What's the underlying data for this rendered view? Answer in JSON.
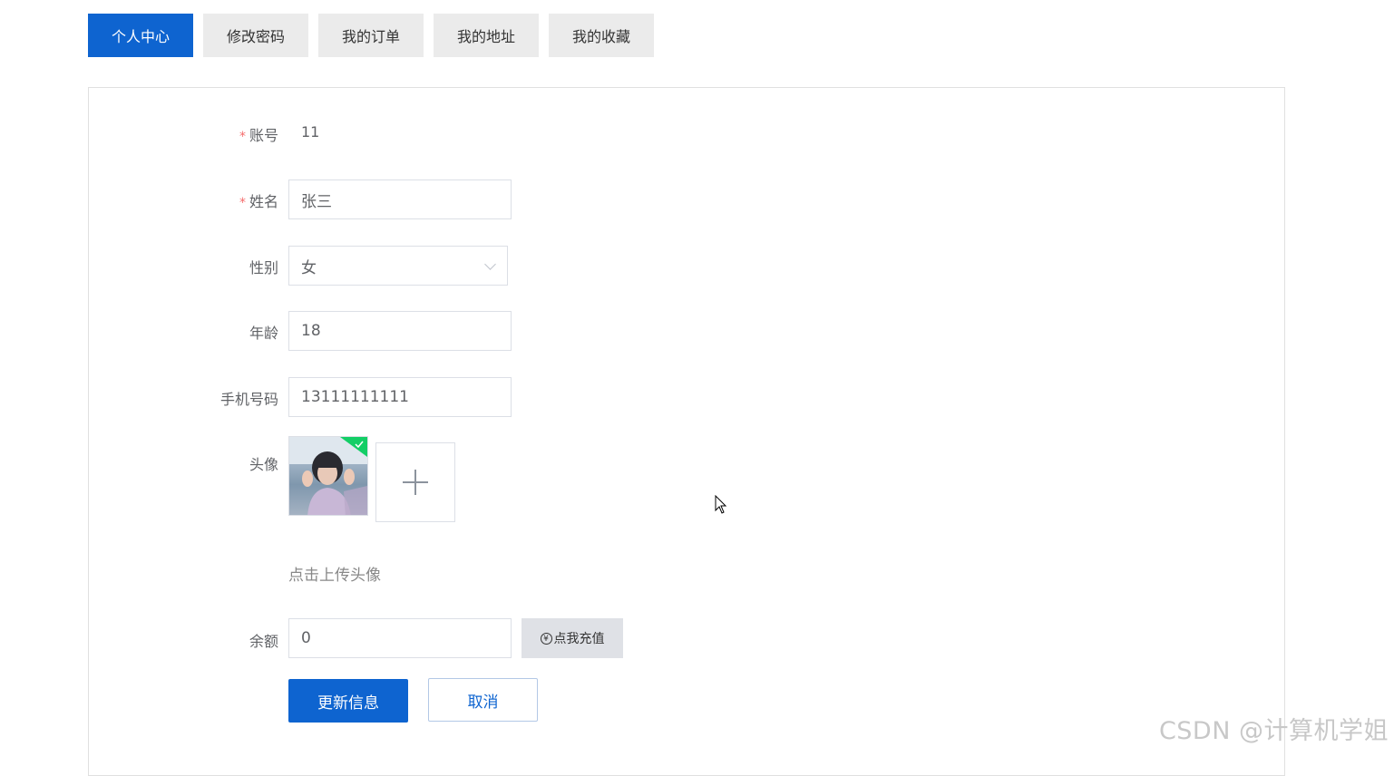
{
  "tabs": [
    {
      "label": "个人中心",
      "active": true
    },
    {
      "label": "修改密码",
      "active": false
    },
    {
      "label": "我的订单",
      "active": false
    },
    {
      "label": "我的地址",
      "active": false
    },
    {
      "label": "我的收藏",
      "active": false
    }
  ],
  "form": {
    "account": {
      "label": "账号",
      "required": "*",
      "value": "11"
    },
    "name": {
      "label": "姓名",
      "required": "*",
      "value": "张三"
    },
    "gender": {
      "label": "性别",
      "value": "女"
    },
    "age": {
      "label": "年龄",
      "value": "18"
    },
    "phone": {
      "label": "手机号码",
      "value": "13111111111"
    },
    "avatar": {
      "label": "头像",
      "tip": "点击上传头像"
    },
    "balance": {
      "label": "余额",
      "value": "0",
      "recharge_label": "点我充值",
      "coin_symbol": "¥"
    }
  },
  "actions": {
    "update_label": "更新信息",
    "cancel_label": "取消"
  },
  "watermark": "CSDN @计算机学姐",
  "colors": {
    "primary": "#0e64d0",
    "required": "#f56c6c",
    "success": "#13ce66"
  }
}
